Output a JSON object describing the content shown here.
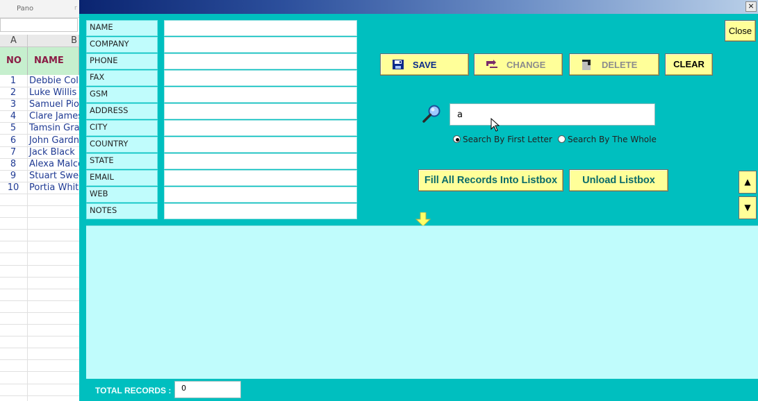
{
  "excel": {
    "ribbon_label": "Pano",
    "ribbon_mark": "r",
    "columns": [
      "A",
      "B"
    ],
    "headers": {
      "no": "NO",
      "name": "NAME"
    },
    "rows": [
      {
        "no": "1",
        "name": "Debbie Colle"
      },
      {
        "no": "2",
        "name": "Luke Willis"
      },
      {
        "no": "3",
        "name": "Samuel Pior"
      },
      {
        "no": "4",
        "name": "Clare James"
      },
      {
        "no": "5",
        "name": "Tamsin Grac"
      },
      {
        "no": "6",
        "name": "John Gardne"
      },
      {
        "no": "7",
        "name": "Jack Black"
      },
      {
        "no": "8",
        "name": "Alexa Malco"
      },
      {
        "no": "9",
        "name": "Stuart Swee"
      },
      {
        "no": "10",
        "name": "Portia White"
      }
    ]
  },
  "form": {
    "window_close": "×",
    "fields": [
      {
        "label": "NAME",
        "value": ""
      },
      {
        "label": "COMPANY",
        "value": ""
      },
      {
        "label": "PHONE",
        "value": ""
      },
      {
        "label": "FAX",
        "value": ""
      },
      {
        "label": "GSM",
        "value": ""
      },
      {
        "label": "ADDRESS",
        "value": ""
      },
      {
        "label": "CITY",
        "value": ""
      },
      {
        "label": "COUNTRY",
        "value": ""
      },
      {
        "label": "STATE",
        "value": ""
      },
      {
        "label": "EMAIL",
        "value": ""
      },
      {
        "label": "WEB",
        "value": ""
      },
      {
        "label": "NOTES",
        "value": ""
      }
    ],
    "buttons": {
      "close": "Close",
      "save": "SAVE",
      "change": "CHANGE",
      "delete": "DELETE",
      "clear": "CLEAR",
      "fill": "Fill All Records Into Listbox",
      "unload": "Unload Listbox"
    },
    "search": {
      "value": "a",
      "options": [
        "Search By First Letter",
        "Search By The Whole"
      ],
      "selected": "Search By First Letter"
    },
    "spin": {
      "up": "▲",
      "down": "▼"
    },
    "total": {
      "label": "TOTAL RECORDS :",
      "value": "0"
    },
    "colors": {
      "background": "#00bfbf",
      "panel": "#c0fcfc",
      "button": "#ffff99"
    },
    "icons": {
      "save": "floppy-icon",
      "change": "swap-icon",
      "delete": "trash-icon",
      "search": "magnifier-icon",
      "arrow": "down-arrow-icon"
    }
  }
}
